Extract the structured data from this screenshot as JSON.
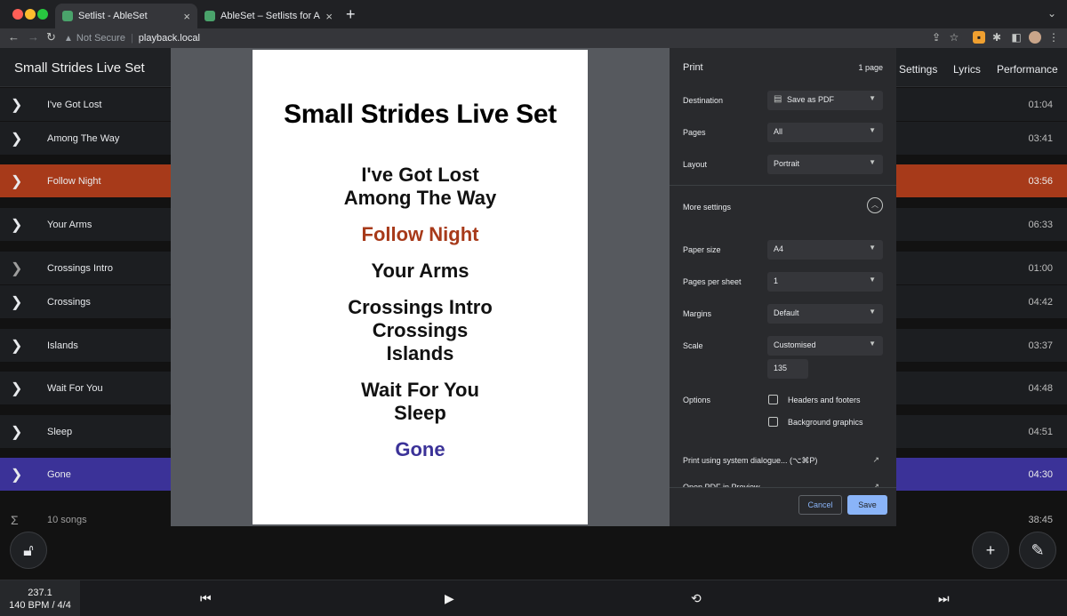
{
  "browser": {
    "tabs": [
      {
        "title": "Setlist - AbleSet",
        "active": true
      },
      {
        "title": "AbleSet – Setlists for Ableton Live",
        "active": false
      }
    ],
    "url_warning": "Not Secure",
    "url": "playback.local"
  },
  "app": {
    "title": "Small Strides Live Set",
    "nav": [
      "Settings",
      "Lyrics",
      "Performance"
    ],
    "songs": [
      {
        "name": "I've Got Lost",
        "duration": "01:04",
        "highlight": ""
      },
      {
        "name": "Among The Way",
        "duration": "03:41",
        "highlight": ""
      },
      {
        "name": "Follow Night",
        "duration": "03:56",
        "highlight": "red"
      },
      {
        "name": "Your Arms",
        "duration": "06:33",
        "highlight": ""
      },
      {
        "name": "Crossings Intro",
        "duration": "01:00",
        "highlight": ""
      },
      {
        "name": "Crossings",
        "duration": "04:42",
        "highlight": ""
      },
      {
        "name": "Islands",
        "duration": "03:37",
        "highlight": ""
      },
      {
        "name": "Wait For You",
        "duration": "04:48",
        "highlight": ""
      },
      {
        "name": "Sleep",
        "duration": "04:51",
        "highlight": ""
      },
      {
        "name": "Gone",
        "duration": "04:30",
        "highlight": "blue"
      }
    ],
    "summary": {
      "count": "10 songs",
      "total": "38:45"
    },
    "transport": {
      "position": "237.1",
      "tempo": "140 BPM / 4/4"
    }
  },
  "print_preview": {
    "title": "Small Strides Live Set",
    "lines": [
      {
        "text": "I've Got Lost",
        "color": "#111111"
      },
      {
        "text": "Among The Way",
        "color": "#111111"
      },
      {
        "text": "Follow Night",
        "color": "#a73a1a"
      },
      {
        "text": "Your Arms",
        "color": "#111111"
      },
      {
        "text": "Crossings Intro",
        "color": "#111111"
      },
      {
        "text": "Crossings",
        "color": "#111111"
      },
      {
        "text": "Islands",
        "color": "#111111"
      },
      {
        "text": "Wait For You",
        "color": "#111111"
      },
      {
        "text": "Sleep",
        "color": "#111111"
      },
      {
        "text": "Gone",
        "color": "#3b3298"
      }
    ]
  },
  "print_dialog": {
    "heading": "Print",
    "page_count": "1 page",
    "destination_label": "Destination",
    "destination_value": "Save as PDF",
    "pages_label": "Pages",
    "pages_value": "All",
    "layout_label": "Layout",
    "layout_value": "Portrait",
    "more_settings": "More settings",
    "paper_size_label": "Paper size",
    "paper_size_value": "A4",
    "pages_per_sheet_label": "Pages per sheet",
    "pages_per_sheet_value": "1",
    "margins_label": "Margins",
    "margins_value": "Default",
    "scale_label": "Scale",
    "scale_value": "Customised",
    "scale_percent": "135",
    "options_label": "Options",
    "option_headers": "Headers and footers",
    "option_background": "Background graphics",
    "system_dialog": "Print using system dialogue... (⌥⌘P)",
    "open_pdf": "Open PDF in Preview",
    "cancel": "Cancel",
    "save": "Save"
  },
  "colors": {
    "accent_red": "#a73a1a",
    "accent_blue": "#3b3298",
    "dialog_primary": "#8ab4f8"
  }
}
